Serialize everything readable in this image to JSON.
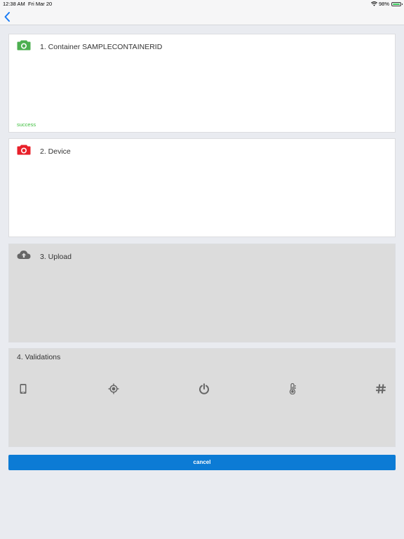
{
  "status_bar": {
    "time": "12:38 AM",
    "date": "Fri Mar 20",
    "battery": "98%",
    "icons": [
      "wifi-icon",
      "battery-icon"
    ]
  },
  "nav": {
    "back_icon": "chevron-left-icon"
  },
  "steps": [
    {
      "title": "1. Container SAMPLECONTAINERID",
      "status": "success",
      "icon": "camera-icon",
      "icon_color": "#4caf50",
      "status_color": "#3fbf3f",
      "background": "#ffffff"
    },
    {
      "title": "2. Device",
      "icon": "camera-icon",
      "icon_color": "#e8202a",
      "background": "#ffffff"
    },
    {
      "title": "3. Upload",
      "icon": "cloud-upload-icon",
      "icon_color": "#666666",
      "background": "#dcdcdc"
    }
  ],
  "validations": {
    "title": "4. Validations",
    "icons": [
      "phone-icon",
      "gps-icon",
      "power-icon",
      "thermometer-icon",
      "hashtag-icon"
    ],
    "icon_color": "#666666"
  },
  "cancel": {
    "label": "cancel",
    "color": "#0c7bd5"
  }
}
